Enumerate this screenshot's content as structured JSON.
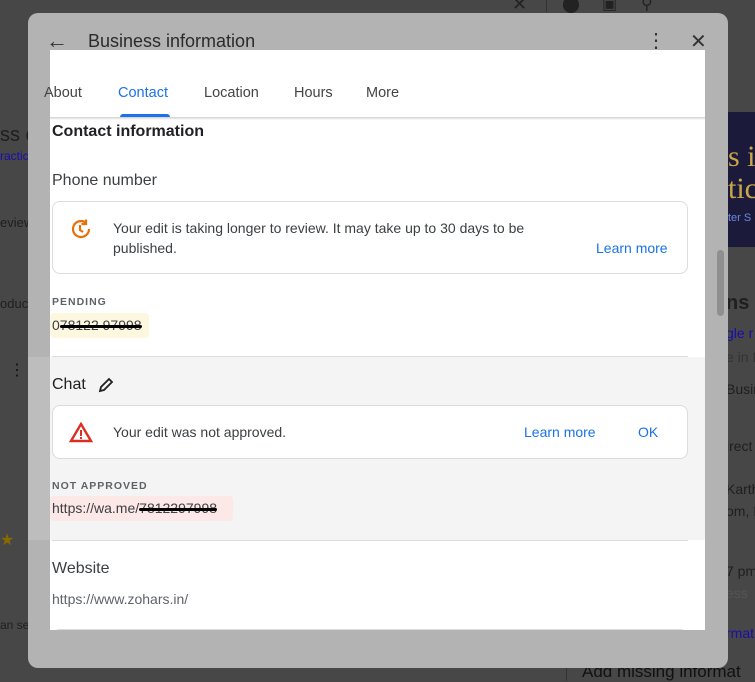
{
  "background": {
    "texts": [
      "ss c",
      "ractic",
      "eview",
      "oduc",
      "an se",
      "s i",
      "tic",
      "ter S",
      "ns",
      "gle r",
      "e in K",
      "Busin",
      "irect",
      "Karth",
      "om, I",
      "7 pm",
      "ess",
      "rmatio",
      "Add missing informat"
    ]
  },
  "dialog": {
    "title": "Business information",
    "tabs": [
      {
        "label": "About"
      },
      {
        "label": "Contact",
        "active": true
      },
      {
        "label": "Location"
      },
      {
        "label": "Hours"
      },
      {
        "label": "More"
      }
    ],
    "section_title": "Contact information",
    "phone": {
      "heading": "Phone number",
      "notice": "Your edit is taking longer to review. It may take up to 30 days to be published.",
      "learn_more": "Learn more",
      "status": "PENDING",
      "value_prefix": "0",
      "value_redacted": "78122 97998"
    },
    "chat": {
      "heading": "Chat",
      "notice": "Your edit was not approved.",
      "learn_more": "Learn more",
      "ok": "OK",
      "status": "NOT APPROVED",
      "value_prefix": "https://wa.me/",
      "value_redacted": "7812297998"
    },
    "website": {
      "heading": "Website",
      "value": "https://www.zohars.in/"
    }
  },
  "colors": {
    "accent": "#1a73e8",
    "pending_bg": "#fef7e0",
    "error_bg": "#fce8e6",
    "warning": "#d93025",
    "pending_icon": "#e8710a"
  }
}
